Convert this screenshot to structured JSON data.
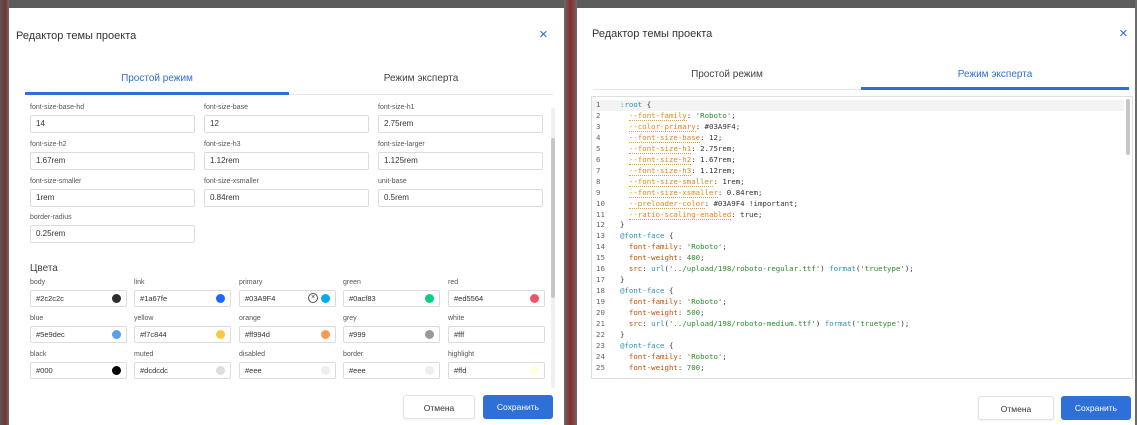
{
  "left": {
    "title": "Редактор темы проекта",
    "tabs": [
      {
        "label": "Простой режим",
        "active": true
      },
      {
        "label": "Режим эксперта",
        "active": false
      }
    ],
    "fields": [
      {
        "label": "font-size-base-hd",
        "value": "14"
      },
      {
        "label": "font-size-base",
        "value": "12"
      },
      {
        "label": "font-size-h1",
        "value": "2.75rem"
      },
      {
        "label": "font-size-h2",
        "value": "1.67rem"
      },
      {
        "label": "font-size-h3",
        "value": "1.12rem"
      },
      {
        "label": "font-size-larger",
        "value": "1.125rem"
      },
      {
        "label": "font-size-smaller",
        "value": "1rem"
      },
      {
        "label": "font-size-xsmaller",
        "value": "0.84rem"
      },
      {
        "label": "unit-base",
        "value": "0.5rem"
      },
      {
        "label": "border-radius",
        "value": "0.25rem"
      }
    ],
    "colors_title": "Цвета",
    "colors": [
      {
        "label": "body",
        "value": "#2c2c2c",
        "swatch": "#2c2c2c"
      },
      {
        "label": "link",
        "value": "#1a67fe",
        "swatch": "#1a67fe"
      },
      {
        "label": "primary",
        "value": "#03A9F4",
        "swatch": "#03A9F4"
      },
      {
        "label": "green",
        "value": "#0acf83",
        "swatch": "#0acf83"
      },
      {
        "label": "red",
        "value": "#ed5564",
        "swatch": "#ed5564"
      },
      {
        "label": "blue",
        "value": "#5e9dec",
        "swatch": "#5e9dec"
      },
      {
        "label": "yellow",
        "value": "#f7c844",
        "swatch": "#f7c844"
      },
      {
        "label": "orange",
        "value": "#ff994d",
        "swatch": "#ff994d"
      },
      {
        "label": "grey",
        "value": "#999",
        "swatch": "#999999"
      },
      {
        "label": "white",
        "value": "#fff",
        "swatch": "#ffffff"
      },
      {
        "label": "black",
        "value": "#000",
        "swatch": "#000000"
      },
      {
        "label": "muted",
        "value": "#dcdcdc",
        "swatch": "#dcdcdc"
      },
      {
        "label": "disabled",
        "value": "#eee",
        "swatch": "#eeeeee"
      },
      {
        "label": "border",
        "value": "#eee",
        "swatch": "#eeeeee"
      },
      {
        "label": "highlight",
        "value": "#ffd",
        "swatch": "#ffffdd"
      }
    ],
    "cancel_label": "Отмена",
    "save_label": "Сохранить"
  },
  "right": {
    "title": "Редактор темы проекта",
    "tabs": [
      {
        "label": "Простой режим",
        "active": false
      },
      {
        "label": "Режим эксперта",
        "active": true
      }
    ],
    "code_lines": [
      [
        {
          "t": ":root",
          "c": "sel"
        },
        {
          "t": " {"
        }
      ],
      [
        {
          "t": "  "
        },
        {
          "t": "--font-family",
          "c": "prop"
        },
        {
          "t": ": "
        },
        {
          "t": "'Roboto'",
          "c": "str"
        },
        {
          "t": ";"
        }
      ],
      [
        {
          "t": "  "
        },
        {
          "t": "--color-primary",
          "c": "prop"
        },
        {
          "t": ": #03A9F4;"
        }
      ],
      [
        {
          "t": "  "
        },
        {
          "t": "--font-size-base",
          "c": "prop"
        },
        {
          "t": ": 12;"
        }
      ],
      [
        {
          "t": "  "
        },
        {
          "t": "--font-size-h1",
          "c": "prop"
        },
        {
          "t": ": 2.75rem;"
        }
      ],
      [
        {
          "t": "  "
        },
        {
          "t": "--font-size-h2",
          "c": "prop"
        },
        {
          "t": ": 1.67rem;"
        }
      ],
      [
        {
          "t": "  "
        },
        {
          "t": "--font-size-h3",
          "c": "prop"
        },
        {
          "t": ": 1.12rem;"
        }
      ],
      [
        {
          "t": "  "
        },
        {
          "t": "--font-size-smaller",
          "c": "prop"
        },
        {
          "t": ": 1rem;"
        }
      ],
      [
        {
          "t": "  "
        },
        {
          "t": "--font-size-xsmaller",
          "c": "prop"
        },
        {
          "t": ": 0.84rem;"
        }
      ],
      [
        {
          "t": "  "
        },
        {
          "t": "--preloader-color",
          "c": "prop"
        },
        {
          "t": ": #03A9F4 !important;"
        }
      ],
      [
        {
          "t": "  "
        },
        {
          "t": "--ratio-scaling-enabled",
          "c": "prop"
        },
        {
          "t": ": true;"
        }
      ],
      [
        {
          "t": "}"
        }
      ],
      [
        {
          "t": "@font-face",
          "c": "at"
        },
        {
          "t": " {"
        }
      ],
      [
        {
          "t": "  "
        },
        {
          "t": "font-family",
          "c": "key"
        },
        {
          "t": ": "
        },
        {
          "t": "'Roboto'",
          "c": "str"
        },
        {
          "t": ";"
        }
      ],
      [
        {
          "t": "  "
        },
        {
          "t": "font-weight",
          "c": "key"
        },
        {
          "t": ": "
        },
        {
          "t": "400",
          "c": "num"
        },
        {
          "t": ";"
        }
      ],
      [
        {
          "t": "  "
        },
        {
          "t": "src",
          "c": "key"
        },
        {
          "t": ": "
        },
        {
          "t": "url",
          "c": "sel"
        },
        {
          "t": "("
        },
        {
          "t": "'../upload/198/roboto-regular.ttf'",
          "c": "str"
        },
        {
          "t": ") "
        },
        {
          "t": "format",
          "c": "sel"
        },
        {
          "t": "("
        },
        {
          "t": "'truetype'",
          "c": "str"
        },
        {
          "t": ");"
        }
      ],
      [
        {
          "t": "}"
        }
      ],
      [
        {
          "t": "@font-face",
          "c": "at"
        },
        {
          "t": " {"
        }
      ],
      [
        {
          "t": "  "
        },
        {
          "t": "font-family",
          "c": "key"
        },
        {
          "t": ": "
        },
        {
          "t": "'Roboto'",
          "c": "str"
        },
        {
          "t": ";"
        }
      ],
      [
        {
          "t": "  "
        },
        {
          "t": "font-weight",
          "c": "key"
        },
        {
          "t": ": "
        },
        {
          "t": "500",
          "c": "num"
        },
        {
          "t": ";"
        }
      ],
      [
        {
          "t": "  "
        },
        {
          "t": "src",
          "c": "key"
        },
        {
          "t": ": "
        },
        {
          "t": "url",
          "c": "sel"
        },
        {
          "t": "("
        },
        {
          "t": "'../upload/198/roboto-medium.ttf'",
          "c": "str"
        },
        {
          "t": ") "
        },
        {
          "t": "format",
          "c": "sel"
        },
        {
          "t": "("
        },
        {
          "t": "'truetype'",
          "c": "str"
        },
        {
          "t": ");"
        }
      ],
      [
        {
          "t": "}"
        }
      ],
      [
        {
          "t": "@font-face",
          "c": "at"
        },
        {
          "t": " {"
        }
      ],
      [
        {
          "t": "  "
        },
        {
          "t": "font-family",
          "c": "key"
        },
        {
          "t": ": "
        },
        {
          "t": "'Roboto'",
          "c": "str"
        },
        {
          "t": ";"
        }
      ],
      [
        {
          "t": "  "
        },
        {
          "t": "font-weight",
          "c": "key"
        },
        {
          "t": ": "
        },
        {
          "t": "700",
          "c": "num"
        },
        {
          "t": ";"
        }
      ]
    ],
    "cancel_label": "Отмена",
    "save_label": "Сохранить"
  },
  "icons": {
    "close": "×",
    "clear": "×"
  }
}
